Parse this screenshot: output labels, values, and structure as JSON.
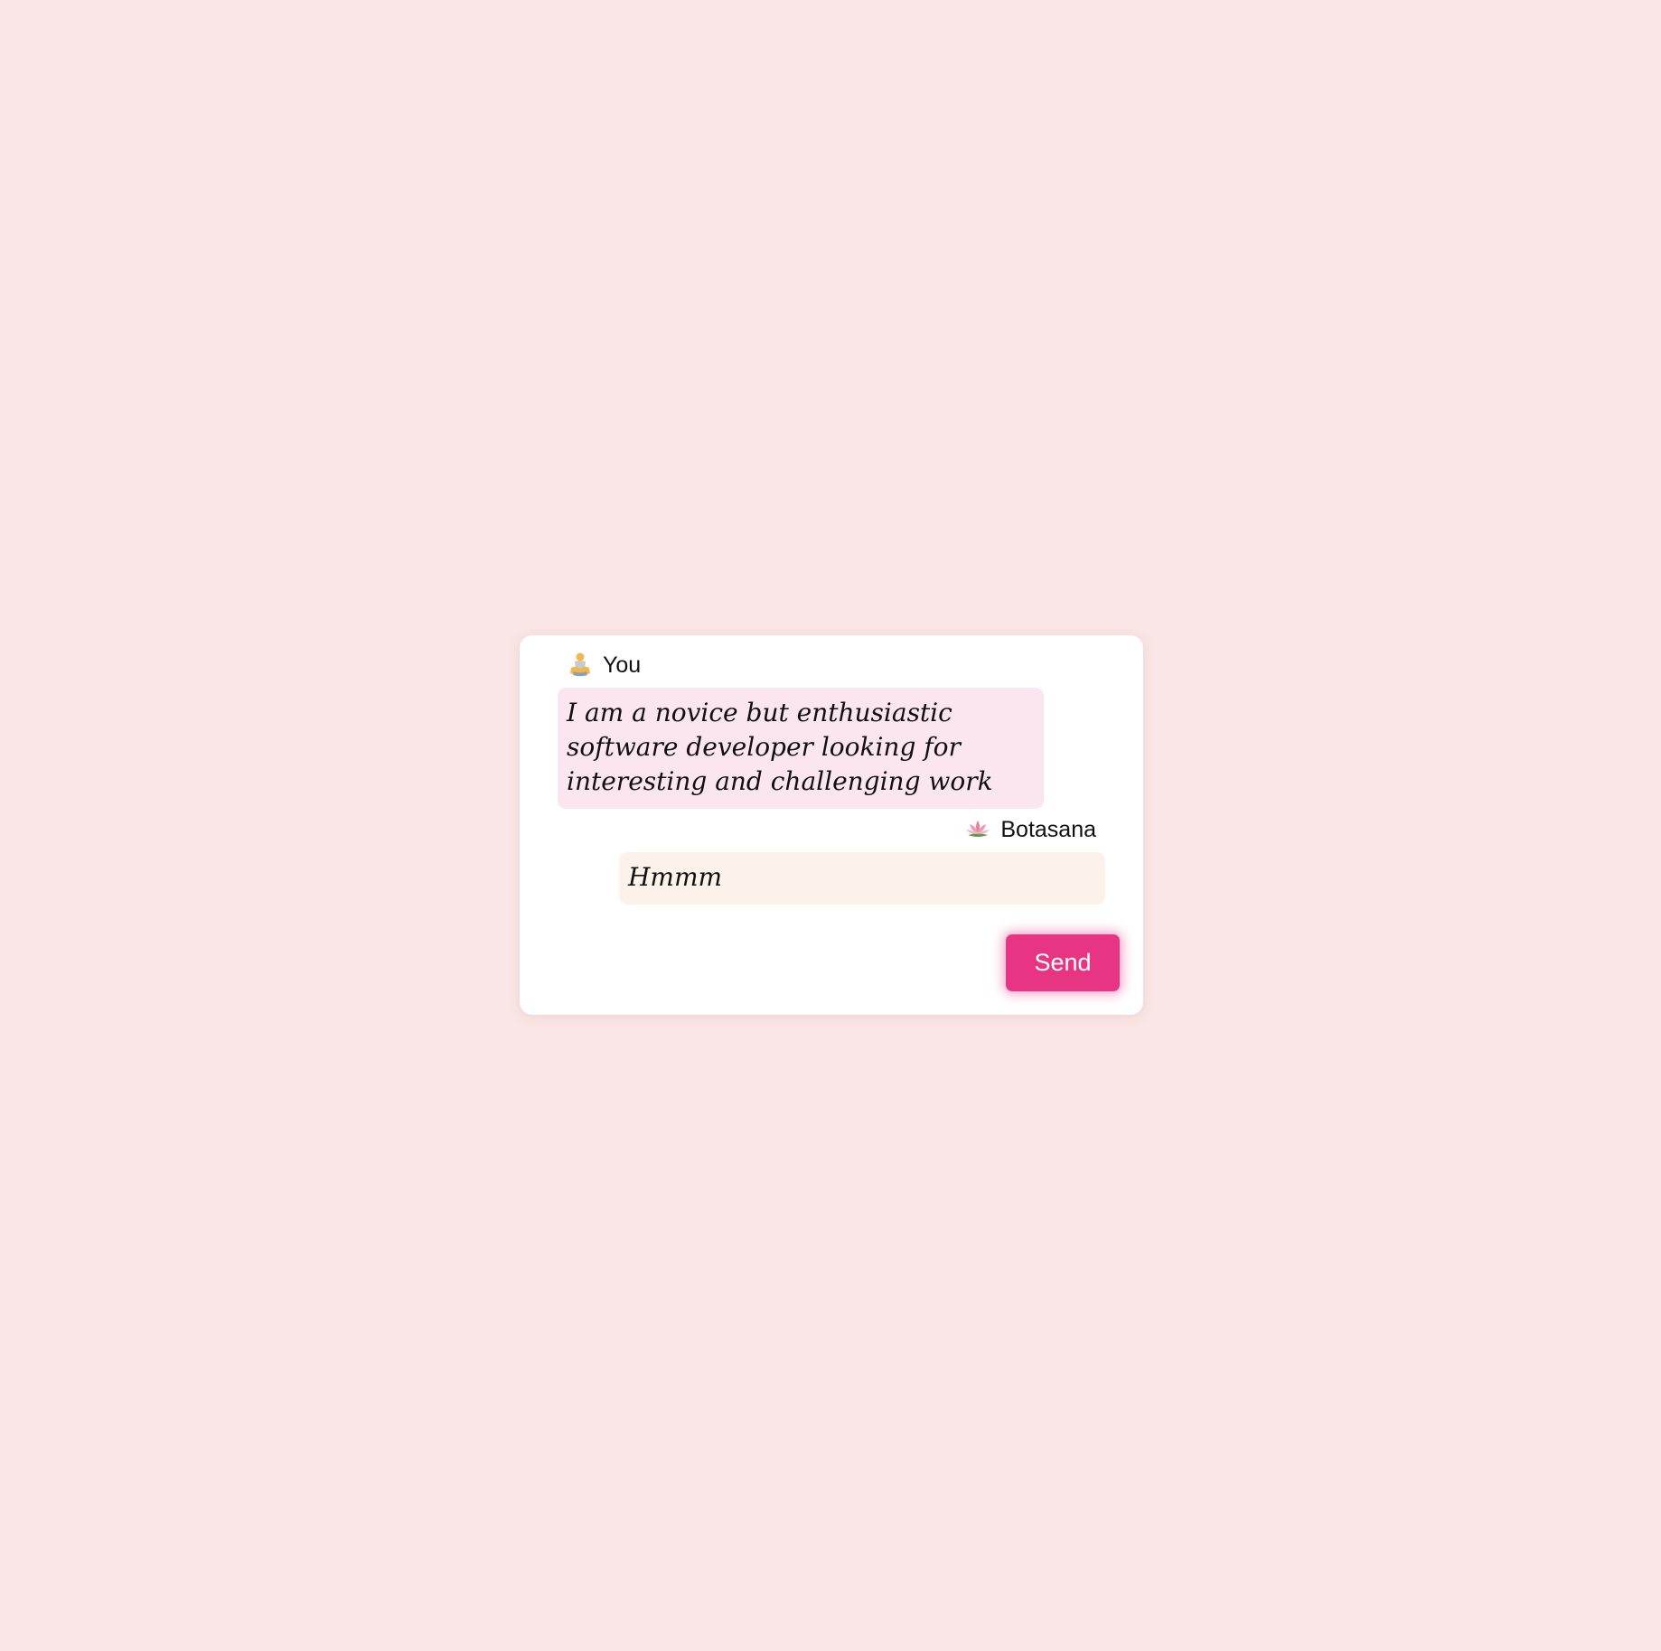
{
  "chat": {
    "messages": [
      {
        "sender": "You",
        "icon": "person-in-lotus-position-icon",
        "text": "I am a novice but enthusiastic software developer looking for interesting and challenging work"
      },
      {
        "sender": "Botasana",
        "icon": "lotus-flower-icon",
        "text": "Hmmm"
      }
    ],
    "send_label": "Send"
  },
  "colors": {
    "page_background": "#fae6e6",
    "user_bubble": "#fbe5ef",
    "bot_bubble": "#fdf2e9",
    "send_button": "#e83583"
  }
}
